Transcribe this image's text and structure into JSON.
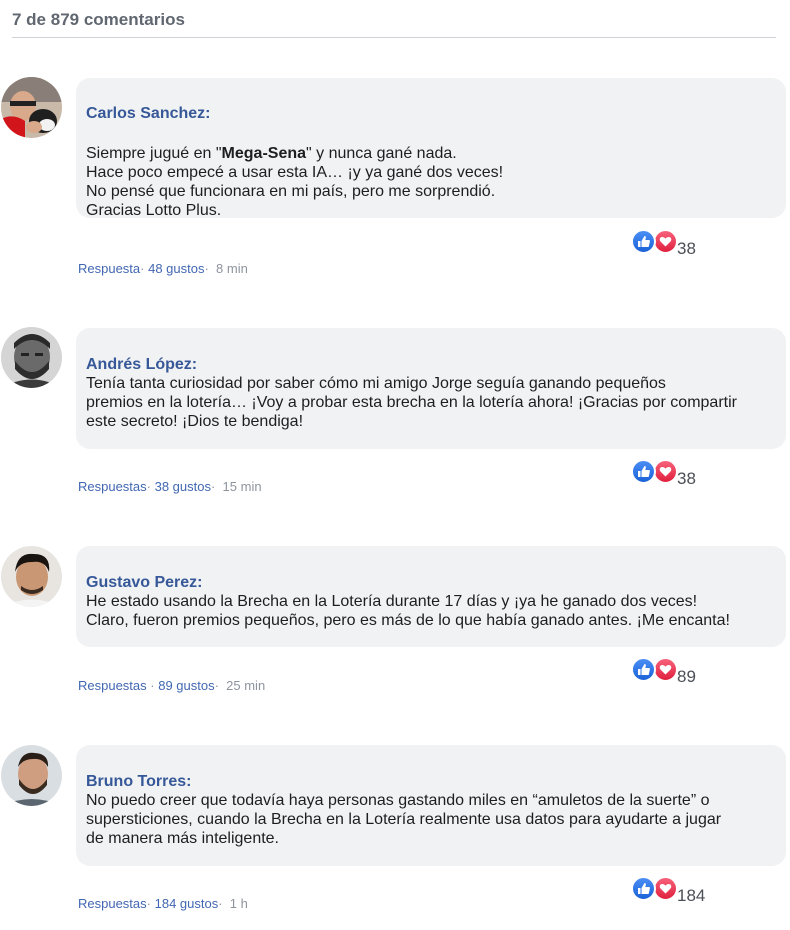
{
  "header": {
    "count": "7 de 879 comentarios"
  },
  "colors": {
    "link": "#365899",
    "bubble": "#f1f2f3",
    "like": "#1877f2",
    "love": "#e0203e"
  },
  "comments": [
    {
      "name": "Carlos Sanchez:",
      "lines": [
        [
          "Siempre jugué en \"",
          "Mega-Sena",
          "\" y nunca gané nada."
        ],
        "Hace poco empecé a usar esta IA… ¡y ya gané dos veces!",
        "No pensé que funcionara en mi país, pero me sorprendió.",
        "Gracias Lotto Plus."
      ],
      "reply": "Respuesta",
      "likes": "48 gustos",
      "time": "8 min",
      "reactions": "38",
      "avatar": "avatar-carlos"
    },
    {
      "name": "Andrés López:",
      "lines": [
        "Tenía tanta curiosidad por saber cómo mi amigo Jorge seguía ganando pequeños",
        "premios en la lotería… ¡Voy a probar esta brecha en la lotería ahora! ¡Gracias por compartir",
        "este secreto! ¡Dios te bendiga!"
      ],
      "reply": "Respuestas",
      "likes": "38 gustos",
      "time": "15 min",
      "reactions": "38",
      "avatar": "avatar-andres"
    },
    {
      "name": "Gustavo Perez:",
      "lines": [
        "He estado usando la Brecha en la Lotería durante 17 días y ¡ya he ganado dos veces!",
        "Claro, fueron premios pequeños, pero es más de lo que había ganado antes. ¡Me encanta!"
      ],
      "reply": "Respuestas",
      "likes": "89 gustos",
      "time": "25 min",
      "reactions": "89",
      "avatar": "avatar-gustavo"
    },
    {
      "name": "Bruno Torres:",
      "lines": [
        "No puedo creer que todavía haya personas gastando miles en “amuletos de la suerte” o",
        "supersticiones, cuando la Brecha en la Lotería realmente usa datos para ayudarte a jugar",
        "de manera más inteligente."
      ],
      "reply": "Respuestas",
      "likes": "184 gustos",
      "time": "1 h",
      "reactions": "184",
      "avatar": "avatar-bruno"
    }
  ]
}
